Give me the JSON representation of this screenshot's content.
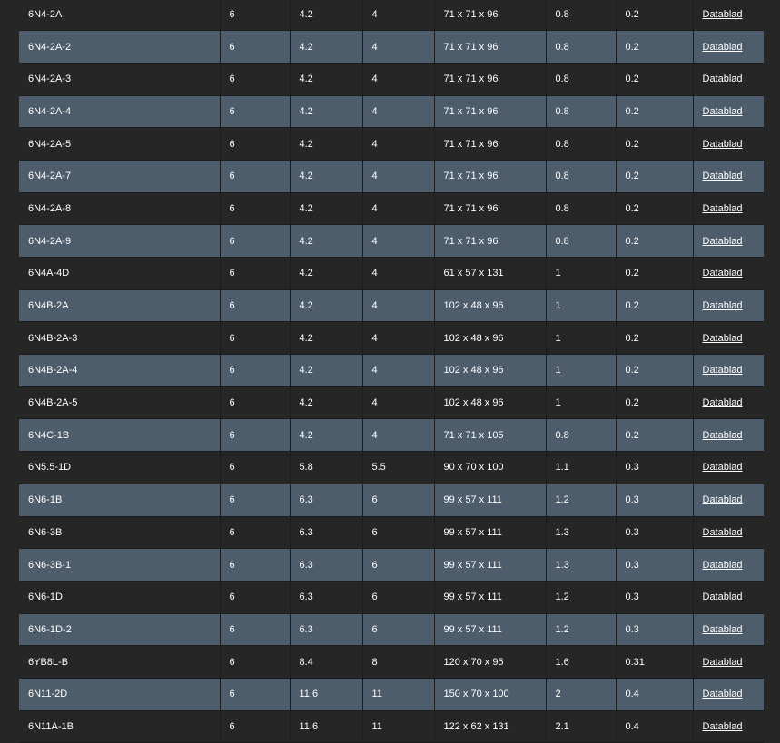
{
  "table": {
    "link_label": "Datablad",
    "rows": [
      {
        "model": "6N4-2A",
        "c1": "6",
        "c2": "4.2",
        "c3": "4",
        "dims": "71 x 71 x 96",
        "c5": "0.8",
        "c6": "0.2"
      },
      {
        "model": "6N4-2A-2",
        "c1": "6",
        "c2": "4.2",
        "c3": "4",
        "dims": "71 x 71 x 96",
        "c5": "0.8",
        "c6": "0.2"
      },
      {
        "model": "6N4-2A-3",
        "c1": "6",
        "c2": "4.2",
        "c3": "4",
        "dims": "71 x 71 x 96",
        "c5": "0.8",
        "c6": "0.2"
      },
      {
        "model": "6N4-2A-4",
        "c1": "6",
        "c2": "4.2",
        "c3": "4",
        "dims": "71 x 71 x 96",
        "c5": "0.8",
        "c6": "0.2"
      },
      {
        "model": "6N4-2A-5",
        "c1": "6",
        "c2": "4.2",
        "c3": "4",
        "dims": "71 x 71 x 96",
        "c5": "0.8",
        "c6": "0.2"
      },
      {
        "model": "6N4-2A-7",
        "c1": "6",
        "c2": "4.2",
        "c3": "4",
        "dims": "71 x 71 x 96",
        "c5": "0.8",
        "c6": "0.2"
      },
      {
        "model": "6N4-2A-8",
        "c1": "6",
        "c2": "4.2",
        "c3": "4",
        "dims": "71 x 71 x 96",
        "c5": "0.8",
        "c6": "0.2"
      },
      {
        "model": "6N4-2A-9",
        "c1": "6",
        "c2": "4.2",
        "c3": "4",
        "dims": "71 x 71 x 96",
        "c5": "0.8",
        "c6": "0.2"
      },
      {
        "model": "6N4A-4D",
        "c1": "6",
        "c2": "4.2",
        "c3": "4",
        "dims": "61 x 57 x 131",
        "c5": "1",
        "c6": "0.2"
      },
      {
        "model": "6N4B-2A",
        "c1": "6",
        "c2": "4.2",
        "c3": "4",
        "dims": "102 x 48 x 96",
        "c5": "1",
        "c6": "0.2"
      },
      {
        "model": "6N4B-2A-3",
        "c1": "6",
        "c2": "4.2",
        "c3": "4",
        "dims": "102 x 48 x 96",
        "c5": "1",
        "c6": "0.2"
      },
      {
        "model": "6N4B-2A-4",
        "c1": "6",
        "c2": "4.2",
        "c3": "4",
        "dims": "102 x 48 x 96",
        "c5": "1",
        "c6": "0.2"
      },
      {
        "model": "6N4B-2A-5",
        "c1": "6",
        "c2": "4.2",
        "c3": "4",
        "dims": "102 x 48 x 96",
        "c5": "1",
        "c6": "0.2"
      },
      {
        "model": "6N4C-1B",
        "c1": "6",
        "c2": "4.2",
        "c3": "4",
        "dims": "71 x 71 x 105",
        "c5": "0.8",
        "c6": "0.2"
      },
      {
        "model": "6N5.5-1D",
        "c1": "6",
        "c2": "5.8",
        "c3": "5.5",
        "dims": "90 x 70 x 100",
        "c5": "1.1",
        "c6": "0.3"
      },
      {
        "model": "6N6-1B",
        "c1": "6",
        "c2": "6.3",
        "c3": "6",
        "dims": "99 x 57 x 111",
        "c5": "1.2",
        "c6": "0.3"
      },
      {
        "model": "6N6-3B",
        "c1": "6",
        "c2": "6.3",
        "c3": "6",
        "dims": "99 x 57 x 111",
        "c5": "1.3",
        "c6": "0.3"
      },
      {
        "model": "6N6-3B-1",
        "c1": "6",
        "c2": "6.3",
        "c3": "6",
        "dims": "99 x 57 x 111",
        "c5": "1.3",
        "c6": "0.3"
      },
      {
        "model": "6N6-1D",
        "c1": "6",
        "c2": "6.3",
        "c3": "6",
        "dims": "99 x 57 x 111",
        "c5": "1.2",
        "c6": "0.3"
      },
      {
        "model": "6N6-1D-2",
        "c1": "6",
        "c2": "6.3",
        "c3": "6",
        "dims": "99 x 57 x 111",
        "c5": "1.2",
        "c6": "0.3"
      },
      {
        "model": "6YB8L-B",
        "c1": "6",
        "c2": "8.4",
        "c3": "8",
        "dims": "120 x 70 x 95",
        "c5": "1.6",
        "c6": "0.31"
      },
      {
        "model": "6N11-2D",
        "c1": "6",
        "c2": "11.6",
        "c3": "11",
        "dims": "150 x 70 x 100",
        "c5": "2",
        "c6": "0.4"
      },
      {
        "model": "6N11A-1B",
        "c1": "6",
        "c2": "11.6",
        "c3": "11",
        "dims": "122 x 62 x 131",
        "c5": "2.1",
        "c6": "0.4"
      }
    ]
  },
  "colors": {
    "row_dark": "#262626",
    "row_light": "#4e5d6c",
    "text": "#ffffff"
  }
}
